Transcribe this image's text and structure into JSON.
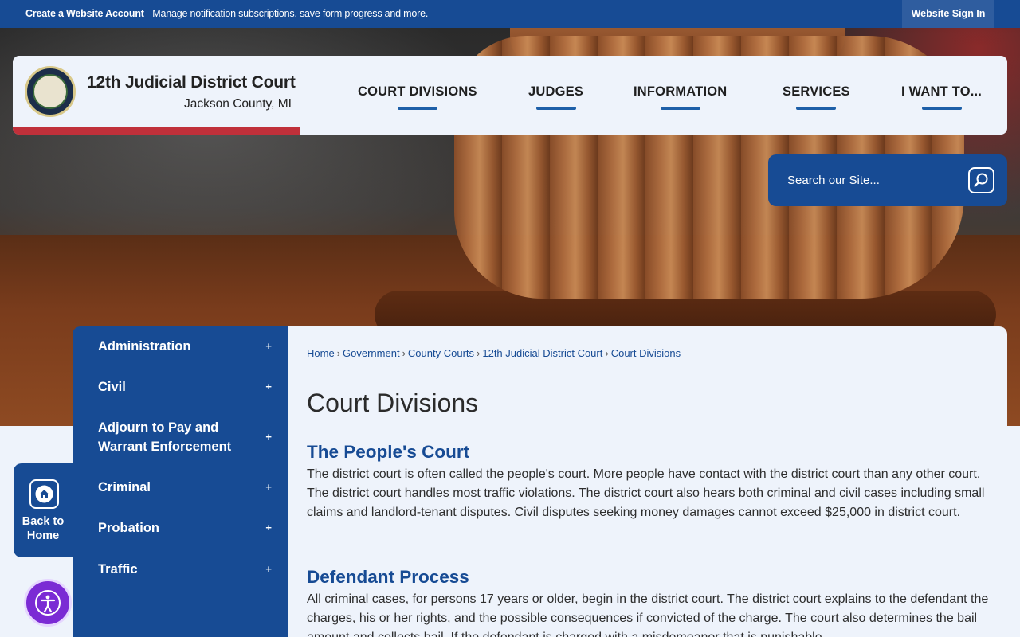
{
  "topbar": {
    "create_account": "Create a Website Account",
    "message": " - Manage notification subscriptions, save form progress and more.",
    "signin": "Website Sign In"
  },
  "header": {
    "title": "12th Judicial District Court",
    "subtitle": "Jackson County, MI",
    "nav": [
      "COURT DIVISIONS",
      "JUDGES",
      "INFORMATION",
      "SERVICES",
      "I WANT TO..."
    ]
  },
  "search": {
    "placeholder": "Search our Site..."
  },
  "sidebar": {
    "items": [
      {
        "label": "Administration",
        "expand": "+"
      },
      {
        "label": "Civil",
        "expand": "+"
      },
      {
        "label": "Adjourn to Pay and Warrant Enforcement",
        "expand": "+"
      },
      {
        "label": "Criminal",
        "expand": "+"
      },
      {
        "label": "Probation",
        "expand": "+"
      },
      {
        "label": "Traffic",
        "expand": "+"
      }
    ]
  },
  "back_home": {
    "label": "Back to Home"
  },
  "breadcrumb": [
    "Home",
    "Government",
    "County Courts",
    "12th Judicial District Court",
    "Court Divisions"
  ],
  "breadcrumb_separator": "›",
  "page": {
    "title": "Court Divisions",
    "sections": [
      {
        "heading": "The People's Court",
        "text": "The district court is often called the people's court. More people have contact with the district court than any other court. The district court handles most traffic violations. The district court also hears both criminal and civil cases including small claims and landlord-tenant disputes. Civil disputes seeking money damages cannot exceed $25,000 in district court."
      },
      {
        "heading": "Defendant Process",
        "text": "All criminal cases, for persons 17 years or older, begin in the district court. The district court explains to the defendant the charges, his or her rights, and the possible consequences if convicted of the charge. The court also determines the bail amount and collects bail. If the defendant is charged with a misdemeanor that is punishable"
      }
    ]
  },
  "colors": {
    "brand_blue": "#174b94",
    "accent_red": "#c0303a",
    "a11y_purple": "#7b2bd4"
  },
  "icons": {
    "search": "search-icon",
    "home": "home-icon",
    "accessibility": "accessibility-icon"
  }
}
